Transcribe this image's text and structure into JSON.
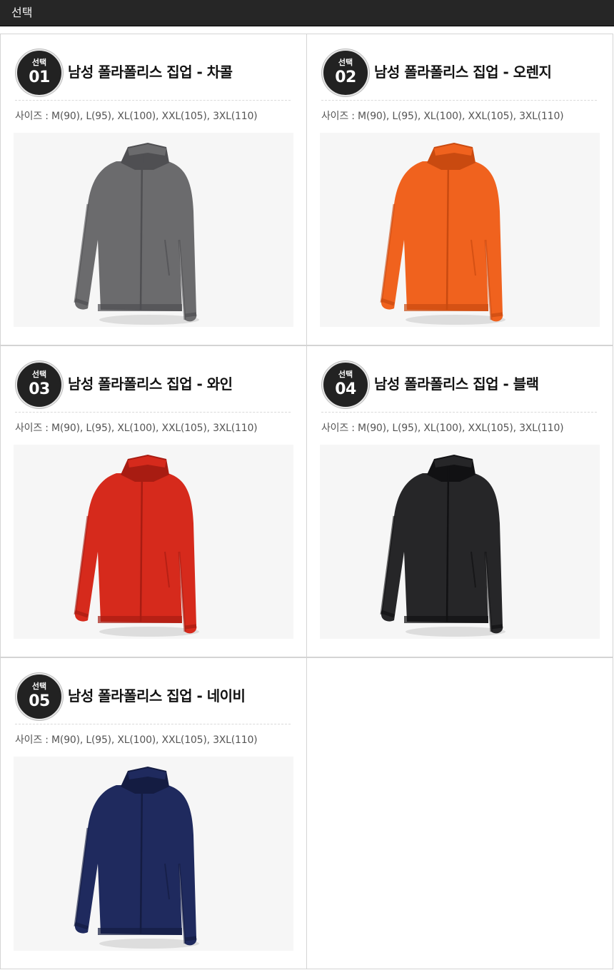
{
  "header": {
    "title": "선택"
  },
  "products": [
    {
      "badge_label": "선택",
      "number": "01",
      "name": "남성 폴라폴리스 집업 - 차콜",
      "sizes": "사이즈 : M(90), L(95), XL(100), XXL(105), 3XL(110)",
      "color": "#6b6b6d",
      "shade": "#4f4f52"
    },
    {
      "badge_label": "선택",
      "number": "02",
      "name": "남성 폴라폴리스 집업 - 오렌지",
      "sizes": "사이즈 : M(90), L(95), XL(100), XXL(105), 3XL(110)",
      "color": "#f0621e",
      "shade": "#c94a10"
    },
    {
      "badge_label": "선택",
      "number": "03",
      "name": "남성 폴라폴리스 집업 - 와인",
      "sizes": "사이즈 : M(90), L(95), XL(100), XXL(105), 3XL(110)",
      "color": "#d62a1c",
      "shade": "#a81c12"
    },
    {
      "badge_label": "선택",
      "number": "04",
      "name": "남성 폴라폴리스 집업 - 블랙",
      "sizes": "사이즈 : M(90), L(95), XL(100), XXL(105), 3XL(110)",
      "color": "#262628",
      "shade": "#111113"
    },
    {
      "badge_label": "선택",
      "number": "05",
      "name": "남성 폴라폴리스 집업 - 네이비",
      "sizes": "사이즈 : M(90), L(95), XL(100), XXL(105), 3XL(110)",
      "color": "#1f2a5e",
      "shade": "#141c42"
    }
  ],
  "jacket_icon": "fleece-jacket-icon"
}
